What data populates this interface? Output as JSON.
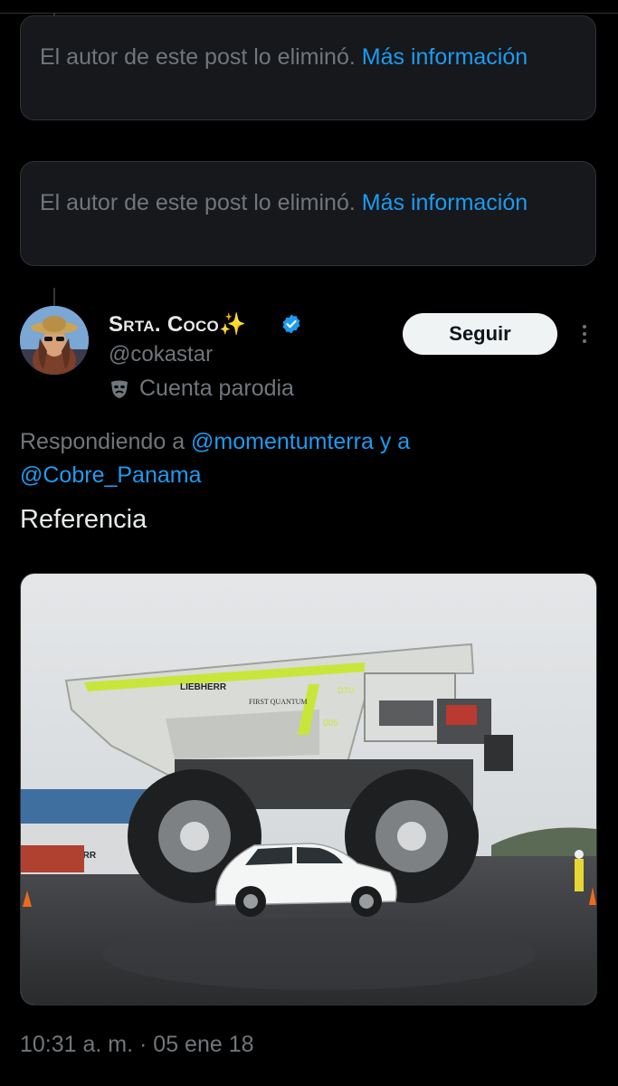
{
  "deleted_posts": [
    {
      "text": "El autor de este post lo eliminó.",
      "link": "Más información"
    },
    {
      "text": "El autor de este post lo eliminó.",
      "link": "Más información"
    }
  ],
  "post": {
    "display_name": "Srta. Coco✨",
    "handle": "@cokastar",
    "parody_label": "Cuenta parodia",
    "follow_label": "Seguir",
    "replying_prefix": "Respondiendo a",
    "reply_to_1": "@momentumterra",
    "reply_and": "y a",
    "reply_to_2": "@Cobre_Panama",
    "text": "Referencia",
    "image_texts": {
      "brand": "LIEBHERR",
      "company": "FIRST QUANTUM",
      "unit": "DTU",
      "unit_number": "005"
    },
    "timestamp": "10:31 a. m. · 05 ene 18"
  },
  "colors": {
    "background": "#000000",
    "accent": "#1d9bf0",
    "muted": "#71767b",
    "text": "#e7e9ea"
  },
  "icons": [
    "verified-badge-icon",
    "parody-mask-icon",
    "more-options-icon"
  ]
}
